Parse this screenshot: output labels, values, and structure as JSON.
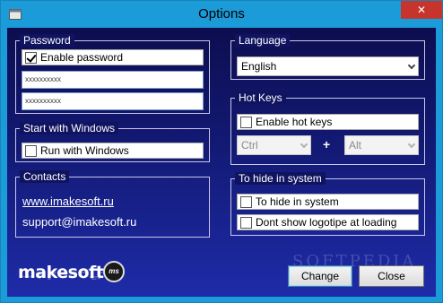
{
  "window": {
    "title": "Options",
    "close_glyph": "✕",
    "icon": "app-window-icon"
  },
  "password": {
    "group_title": "Password",
    "enable_label": "Enable password",
    "enable_checked": true,
    "field1_value": "xxxxxxxxxx",
    "field2_value": "xxxxxxxxxx"
  },
  "startup": {
    "group_title": "Start with Windows",
    "run_label": "Run with Windows",
    "run_checked": false
  },
  "contacts": {
    "group_title": "Contacts",
    "website": "www.imakesoft.ru",
    "email": "support@imakesoft.ru"
  },
  "language": {
    "group_title": "Language",
    "selected": "English"
  },
  "hotkeys": {
    "group_title": "Hot Keys",
    "enable_label": "Enable hot keys",
    "enable_checked": false,
    "modifier": "Ctrl",
    "plus": "+",
    "second": "Alt"
  },
  "hide": {
    "group_title": "To hide in system",
    "hide_label": "To hide in system",
    "hide_checked": false,
    "logo_label": "Dont show logotipe at loading",
    "logo_checked": false
  },
  "brand": {
    "logo_text": "makesoft",
    "badge_text": "ms"
  },
  "buttons": {
    "change": "Change",
    "close": "Close"
  },
  "watermark": "SOFTPEDIA"
}
